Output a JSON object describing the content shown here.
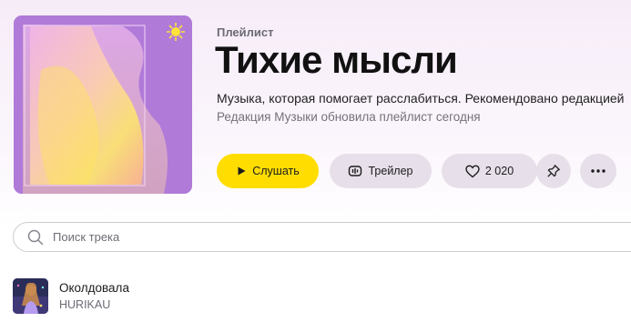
{
  "playlist": {
    "kind_label": "Плейлист",
    "title": "Тихие мысли",
    "description": "Музыка, которая помогает расслабиться. Рекомендовано редакцией",
    "updated_text": "Редакция Музыки обновила плейлист сегодня"
  },
  "actions": {
    "play_label": "Слушать",
    "trailer_label": "Трейлер",
    "likes_count": "2 020"
  },
  "search": {
    "placeholder": "Поиск трека"
  },
  "tracks": [
    {
      "title": "Околдовала",
      "artist": "HURIKAU"
    }
  ],
  "colors": {
    "accent_play": "#ffdd00",
    "secondary_button": "#e7dfea",
    "cover_base": "#b27ad8"
  }
}
